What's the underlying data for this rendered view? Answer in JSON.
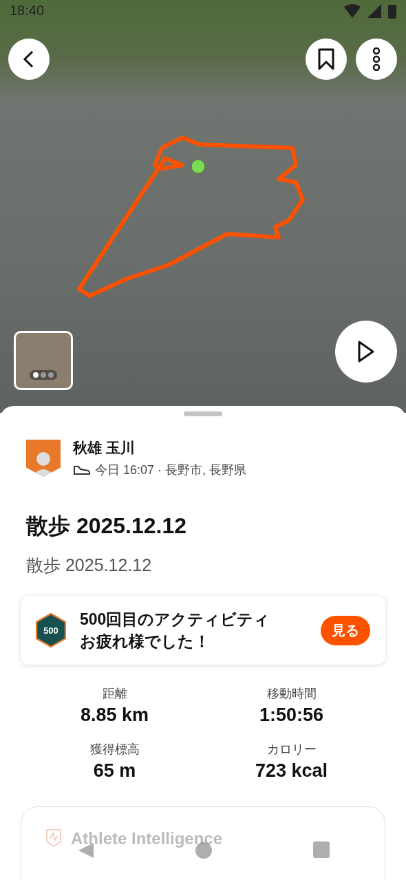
{
  "status_bar": {
    "time": "18:40"
  },
  "map": {
    "photo_dots": [
      {
        "selected": true
      },
      {
        "selected": false
      },
      {
        "selected": false
      }
    ]
  },
  "athlete": {
    "name": "秋雄 玉川",
    "meta": "今日 16:07 · 長野市, 長野県"
  },
  "activity": {
    "title": "散歩 2025.12.12",
    "description": "散歩 2025.12.12"
  },
  "milestone": {
    "badge": "500",
    "lines": [
      "500回目のアクティビティ",
      "お疲れ様でした！"
    ],
    "button": "見る"
  },
  "stats": [
    {
      "label": "距離",
      "value": "8.85 km"
    },
    {
      "label": "移動時間",
      "value": "1:50:56"
    },
    {
      "label": "獲得標高",
      "value": "65 m"
    },
    {
      "label": "カロリー",
      "value": "723 kcal"
    }
  ],
  "insight_card": {
    "title": "Athlete Intelligence"
  }
}
